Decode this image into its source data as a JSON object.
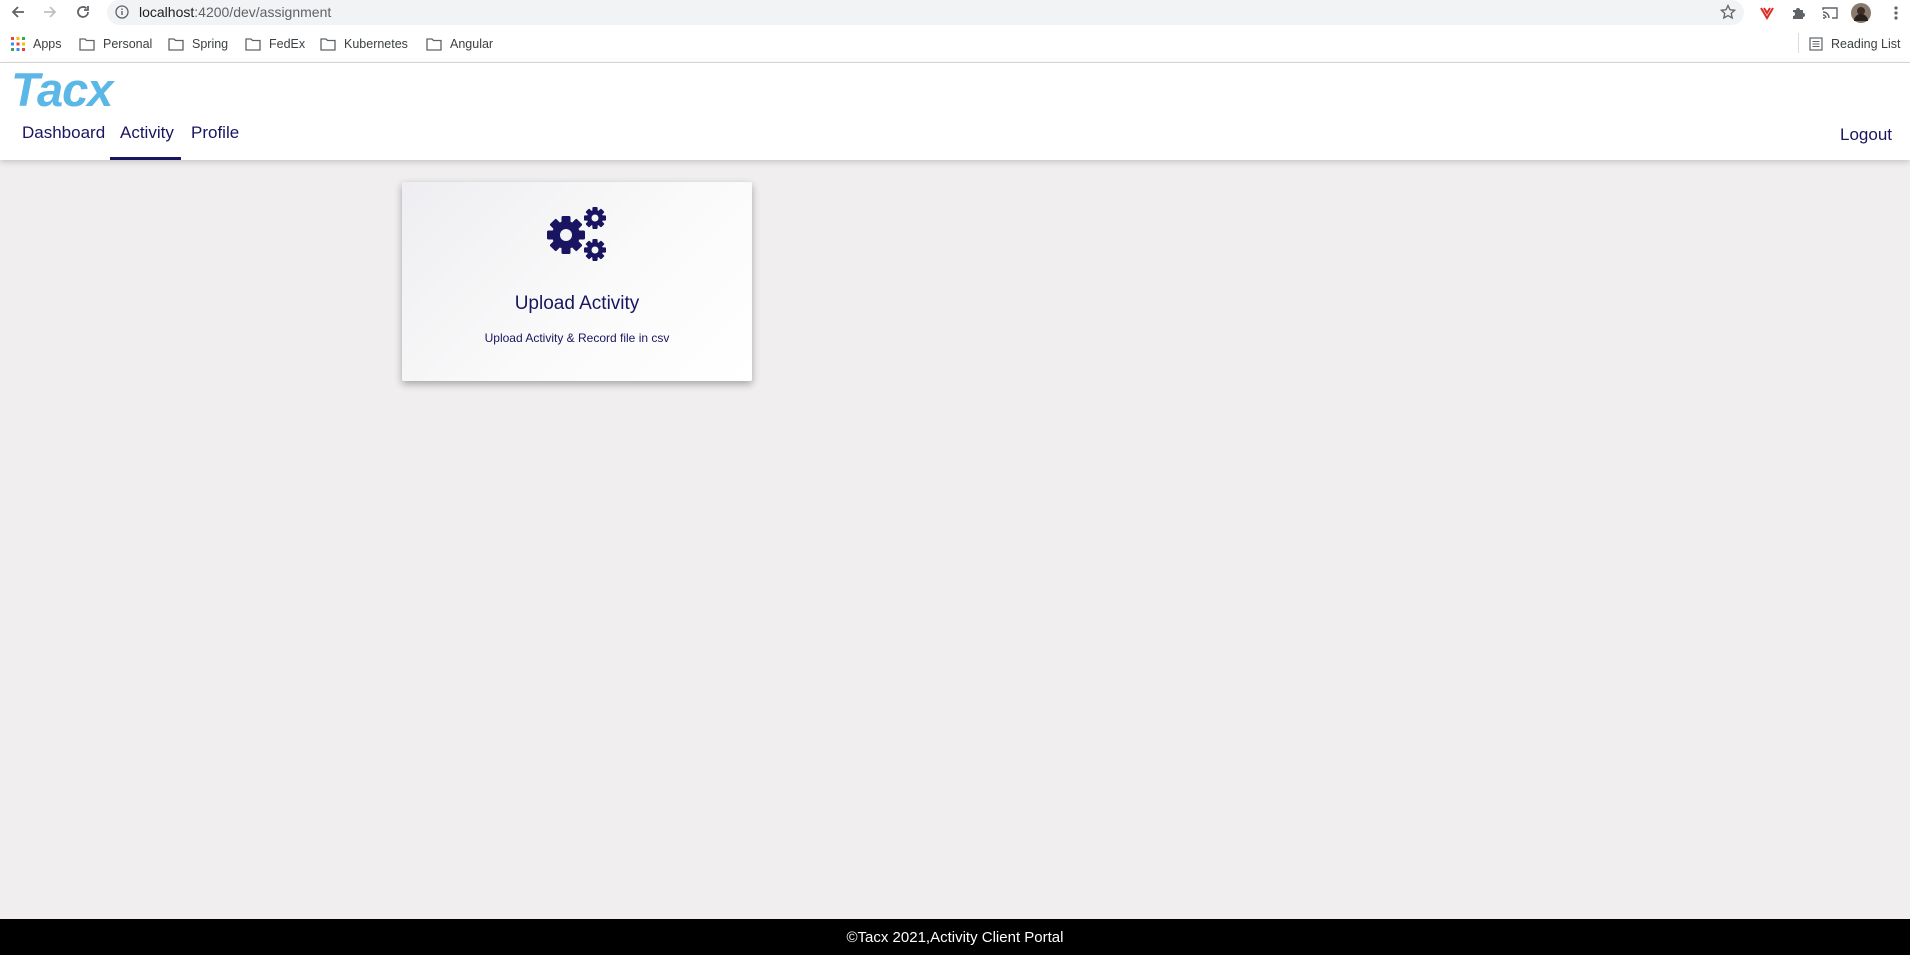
{
  "browser": {
    "url_host": "localhost",
    "url_path": ":4200/dev/assignment",
    "bookmarks": [
      {
        "label": "Apps"
      },
      {
        "label": "Personal"
      },
      {
        "label": "Spring"
      },
      {
        "label": "FedEx"
      },
      {
        "label": "Kubernetes"
      },
      {
        "label": "Angular"
      }
    ],
    "reading_list": "Reading List"
  },
  "header": {
    "logo": "Tacx",
    "tabs": [
      {
        "label": "Dashboard"
      },
      {
        "label": "Activity",
        "active": true
      },
      {
        "label": "Profile"
      }
    ],
    "logout": "Logout",
    "accent_color": "#1a1560",
    "logo_color": "#5bb7e5"
  },
  "card": {
    "icon": "gears-icon",
    "title": "Upload Activity",
    "subtitle": "Upload Activity & Record file in csv"
  },
  "footer": {
    "text": "©Tacx 2021,Activity Client Portal"
  }
}
